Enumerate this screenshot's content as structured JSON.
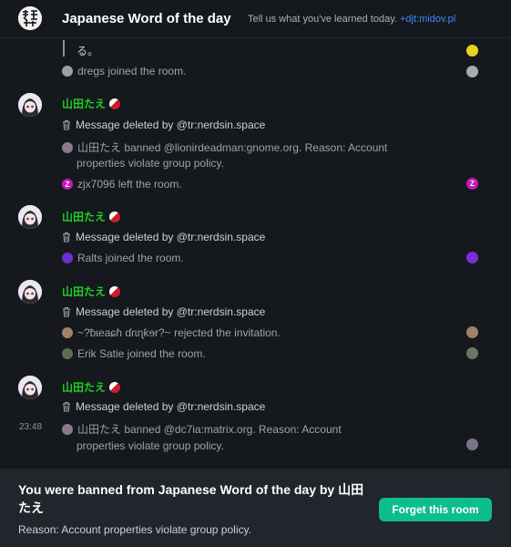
{
  "header": {
    "title": "Japanese Word of the day",
    "topic": "Tell us what you've learned today.",
    "topic_link": "+djt:midov.pl"
  },
  "timeline": {
    "quote_text": "る。",
    "event_dregs": "dregs joined the room.",
    "group1": {
      "sender": "山田たえ",
      "deleted": "Message deleted by @tr:nerdsin.space",
      "ban_line1": "山田たえ banned @lionirdeadman:gnome.org. Reason: Account",
      "ban_line2": "properties violate group policy.",
      "left": "zjx7096 left the room."
    },
    "group2": {
      "sender": "山田たえ",
      "deleted": "Message deleted by @tr:nerdsin.space",
      "joined": "Ralts joined the room."
    },
    "group3": {
      "sender": "山田たえ",
      "deleted": "Message deleted by @tr:nerdsin.space",
      "rejected": "~?ƀɩeaɕɦ ɗɾɩɳƙɘr?~ rejected the invitation.",
      "joined": "Erik Satie joined the room."
    },
    "group4": {
      "sender": "山田たえ",
      "deleted": "Message deleted by @tr:nerdsin.space",
      "timestamp": "23:48",
      "ban_line1": "山田たえ banned @dc7ia:matrix.org. Reason: Account",
      "ban_line2": "properties violate group policy."
    }
  },
  "banner": {
    "title": "You were banned from Japanese Word of the day by 山田たえ",
    "reason": "Reason: Account properties violate group policy.",
    "forget_label": "Forget this room"
  },
  "colors": {
    "background": "#15191e",
    "accent_green": "#0dbd8b",
    "sender_green": "#1fd01f",
    "link_blue": "#3d8bfd"
  }
}
